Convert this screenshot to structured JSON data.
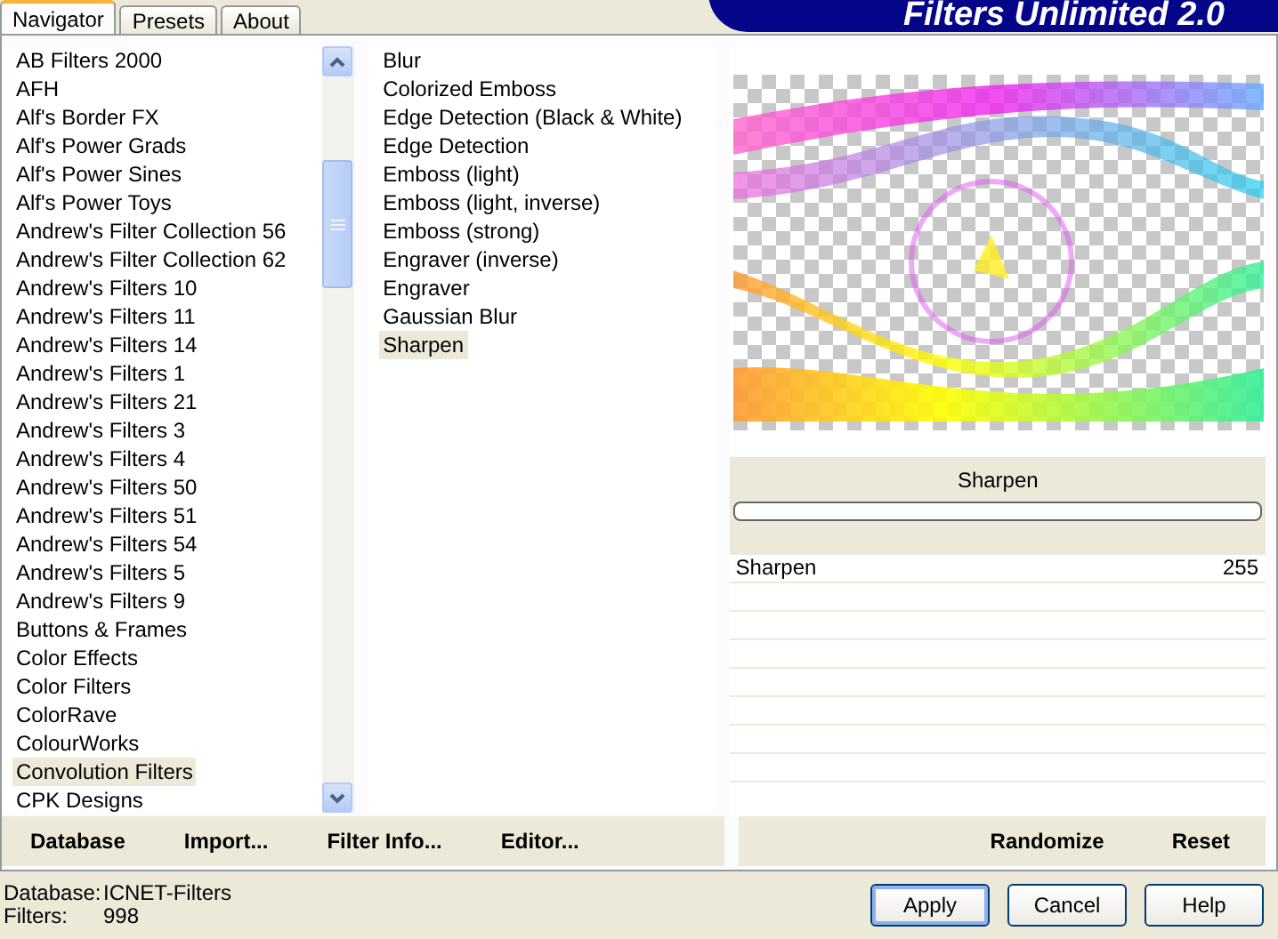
{
  "window": {
    "title": "Filters Unlimited 2.0"
  },
  "tabs": [
    {
      "label": "Navigator",
      "selected": true
    },
    {
      "label": "Presets",
      "selected": false
    },
    {
      "label": "About",
      "selected": false
    }
  ],
  "categories": [
    {
      "label": "AB Filters 2000",
      "selected": false
    },
    {
      "label": "AFH",
      "selected": false
    },
    {
      "label": "Alf's Border FX",
      "selected": false
    },
    {
      "label": "Alf's Power Grads",
      "selected": false
    },
    {
      "label": "Alf's Power Sines",
      "selected": false
    },
    {
      "label": "Alf's Power Toys",
      "selected": false
    },
    {
      "label": "Andrew's Filter Collection 56",
      "selected": false
    },
    {
      "label": "Andrew's Filter Collection 62",
      "selected": false
    },
    {
      "label": "Andrew's Filters 10",
      "selected": false
    },
    {
      "label": "Andrew's Filters 11",
      "selected": false
    },
    {
      "label": "Andrew's Filters 14",
      "selected": false
    },
    {
      "label": "Andrew's Filters 1",
      "selected": false
    },
    {
      "label": "Andrew's Filters 21",
      "selected": false
    },
    {
      "label": "Andrew's Filters 3",
      "selected": false
    },
    {
      "label": "Andrew's Filters 4",
      "selected": false
    },
    {
      "label": "Andrew's Filters 50",
      "selected": false
    },
    {
      "label": "Andrew's Filters 51",
      "selected": false
    },
    {
      "label": "Andrew's Filters 54",
      "selected": false
    },
    {
      "label": "Andrew's Filters 5",
      "selected": false
    },
    {
      "label": "Andrew's Filters 9",
      "selected": false
    },
    {
      "label": "Buttons & Frames",
      "selected": false
    },
    {
      "label": "Color Effects",
      "selected": false
    },
    {
      "label": "Color Filters",
      "selected": false
    },
    {
      "label": "ColorRave",
      "selected": false
    },
    {
      "label": "ColourWorks",
      "selected": false
    },
    {
      "label": "Convolution Filters",
      "selected": true
    },
    {
      "label": "CPK Designs",
      "selected": false
    }
  ],
  "filters": [
    {
      "label": "Blur",
      "selected": false
    },
    {
      "label": "Colorized Emboss",
      "selected": false
    },
    {
      "label": "Edge Detection (Black & White)",
      "selected": false
    },
    {
      "label": "Edge Detection",
      "selected": false
    },
    {
      "label": "Emboss (light)",
      "selected": false
    },
    {
      "label": "Emboss (light, inverse)",
      "selected": false
    },
    {
      "label": "Emboss (strong)",
      "selected": false
    },
    {
      "label": "Engraver (inverse)",
      "selected": false
    },
    {
      "label": "Engraver",
      "selected": false
    },
    {
      "label": "Gaussian Blur",
      "selected": false
    },
    {
      "label": "Sharpen",
      "selected": true
    }
  ],
  "preview": {
    "filter_name": "Sharpen",
    "progress": {
      "level": 0
    }
  },
  "parameters": [
    {
      "name": "Sharpen",
      "value": "255"
    }
  ],
  "panel_buttons": [
    "Database",
    "Import...",
    "Filter Info...",
    "Editor..."
  ],
  "preview_buttons": [
    "Randomize",
    "Reset"
  ],
  "status": [
    {
      "label": "Database:",
      "value": "ICNET-Filters"
    },
    {
      "label": "Filters:",
      "value": "998"
    }
  ],
  "dialog_buttons": [
    {
      "label": "Apply",
      "default": true
    },
    {
      "label": "Cancel",
      "default": false
    },
    {
      "label": "Help",
      "default": false
    }
  ]
}
